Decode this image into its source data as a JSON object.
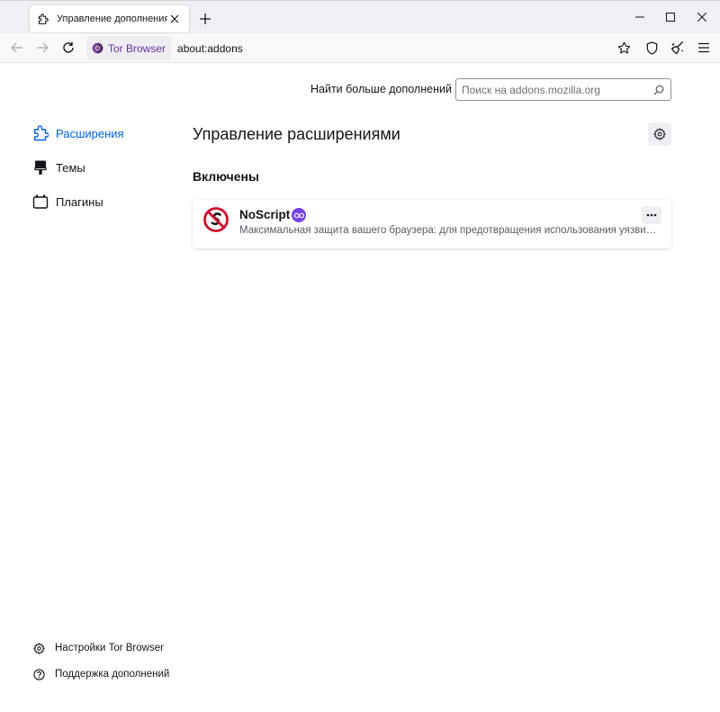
{
  "tab": {
    "title": "Управление дополнениями",
    "icon": "puzzle-icon"
  },
  "navbar": {
    "identity_label": "Tor Browser",
    "url": "about:addons"
  },
  "search": {
    "label": "Найти больше дополнений",
    "placeholder": "Поиск на addons.mozilla.org"
  },
  "sidebar": {
    "items": [
      {
        "label": "Расширения",
        "icon": "puzzle-icon",
        "active": true
      },
      {
        "label": "Темы",
        "icon": "brush-icon",
        "active": false
      },
      {
        "label": "Плагины",
        "icon": "plugin-icon",
        "active": false
      }
    ],
    "footer": [
      {
        "label": "Настройки Tor Browser",
        "icon": "gear-icon"
      },
      {
        "label": "Поддержка дополнений",
        "icon": "help-icon"
      }
    ]
  },
  "main": {
    "heading": "Управление расширениями",
    "section_title": "Включены",
    "addons": [
      {
        "name": "NoScript",
        "description": "Максимальная защита вашего браузера: для предотвращения использования уязвимостей браузера",
        "recommended": true
      }
    ]
  },
  "colors": {
    "accent": "#0061e0",
    "tor_purple": "#6a2ea6",
    "badge_purple": "#7542e5"
  }
}
